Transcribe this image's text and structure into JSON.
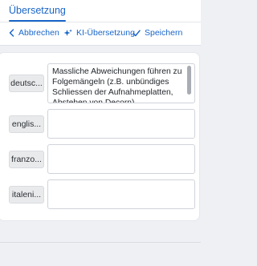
{
  "header": {
    "tab_label": "Übersetzung"
  },
  "toolbar": {
    "cancel_label": "Abbrechen",
    "ai_label": "KI-Übersetzung",
    "save_label": "Speichern"
  },
  "rows": [
    {
      "language": "deutsc...",
      "text": "Massliche Abweichungen führen zu Folgemängeln (z.B. unbündiges Schliessen der Aufnahmeplatten, Abstehen von Decorn)"
    },
    {
      "language": "englis...",
      "text": ""
    },
    {
      "language": "franzo...",
      "text": ""
    },
    {
      "language": "italeni...",
      "text": ""
    }
  ],
  "colors": {
    "accent": "#1a66c8",
    "background": "#eef0f4",
    "card": "#ffffff"
  }
}
